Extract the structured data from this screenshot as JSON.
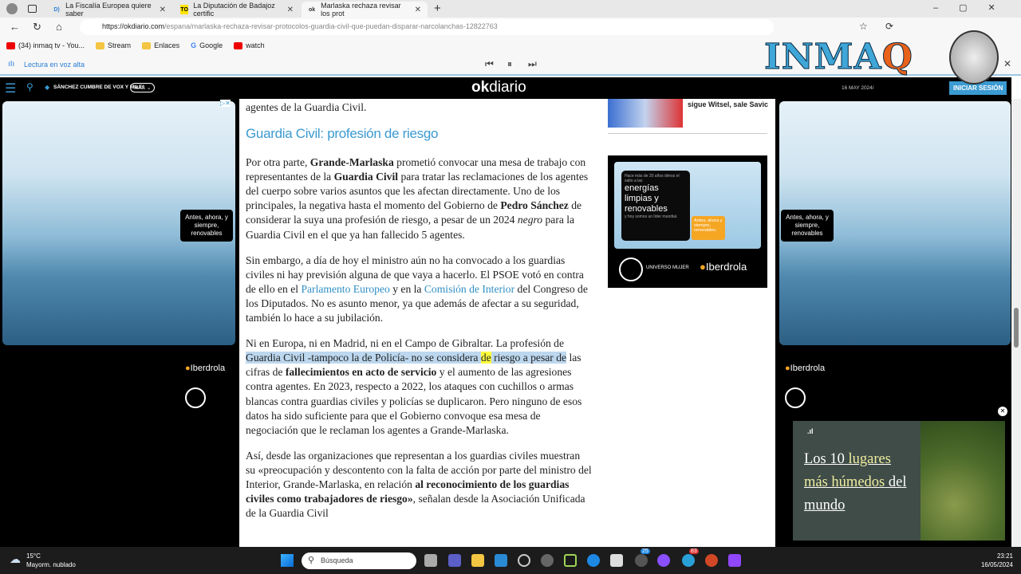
{
  "browser": {
    "tabs": [
      {
        "label": "La Fiscalía Europea quiere saber",
        "icon": "D)"
      },
      {
        "label": "La Diputación de Badajoz certific",
        "icon": "TO"
      },
      {
        "label": "Marlaska rechaza revisar los prot",
        "icon": "ok",
        "active": true
      }
    ],
    "url_domain": "https://okdiario.com",
    "url_path": "/espana/marlaska-rechaza-revisar-protocolos-guardia-civil-que-puedan-disparar-narcolanchas-12822763",
    "bookmarks": [
      "(34) inmaq tv - You...",
      "Stream",
      "Enlaces",
      "Google",
      "watch"
    ],
    "read_aloud": "Lectura en voz alta",
    "watermark": "INMAQ"
  },
  "site": {
    "ticker": "SÁNCHEZ CUMBRE DE VOX Y MILEI",
    "more": "MÁS",
    "logo_ok": "ok",
    "logo_rest": "diario",
    "date": "16 MAY 2024/",
    "login": "INICIAR SESIÓN"
  },
  "ads": {
    "left_tag": "Antes, ahora, y siempre, renovables",
    "brand": "Iberdrola",
    "mujer": "UNIVERSO MUJER",
    "center_heading": "energías limpias y renovables",
    "center_small": "Hace más de 20 años dimos el salto a las",
    "center_small2": "y hoy somos un líder mundial.",
    "center_orange": "Antes, ahora y siempre, renovables.",
    "promo_title_parts": [
      "Los 10 ",
      "lugares",
      " más húmedos",
      " del mundo"
    ]
  },
  "sidebar": {
    "related_title": "sigue Witsel, sale Savic"
  },
  "article": {
    "p0": "agentes de la Guardia Civil.",
    "heading": "Guardia Civil: profesión de riesgo",
    "p1": [
      [
        "Por otra parte, ",
        ""
      ],
      [
        "Grande-Marlaska",
        "b"
      ],
      [
        " prometió convocar una mesa de trabajo con representantes de la ",
        ""
      ],
      [
        "Guardia Civil",
        "b"
      ],
      [
        " para tratar las reclamaciones de los agentes del cuerpo sobre varios asuntos que les afectan directamente. Uno de los principales, la negativa hasta el momento del Gobierno de ",
        ""
      ],
      [
        "Pedro Sánchez",
        "b"
      ],
      [
        " de considerar la suya una profesión de riesgo, a pesar de un 2024 ",
        ""
      ],
      [
        "negro",
        "i"
      ],
      [
        " para la Guardia Civil en el que ya han fallecido 5 agentes.",
        ""
      ]
    ],
    "p2": [
      [
        "Sin embargo, a día de hoy el ministro aún no ha convocado a los guardias civiles ni hay previsión alguna de que vaya a hacerlo. El PSOE votó en contra de ello en el ",
        ""
      ],
      [
        "Parlamento Europeo",
        "a"
      ],
      [
        " y en la ",
        ""
      ],
      [
        "Comisión de Interior",
        "a"
      ],
      [
        " del Congreso de los Diputados. No es asunto menor, ya que además de afectar a su seguridad, también lo hace a su jubilación.",
        ""
      ]
    ],
    "p3": [
      [
        "Ni en Europa, ni en Madrid, ni en el Campo de Gibraltar. La profesión de ",
        ""
      ],
      [
        "Guardia Civil -tampoco la de Policía- no se considera ",
        "hl"
      ],
      [
        "de",
        "hly"
      ],
      [
        " riesgo a pesar de",
        "hl"
      ],
      [
        " las cifras de ",
        ""
      ],
      [
        "fallecimientos en acto de servicio",
        "b"
      ],
      [
        " y el aumento de las agresiones contra agentes. En 2023, respecto a 2022, los ataques con cuchillos o armas blancas contra guardias civiles y policías se duplicaron. Pero ninguno de esos datos ha sido suficiente para que el Gobierno convoque esa mesa de negociación que le reclaman los agentes a Grande-Marlaska.",
        ""
      ]
    ],
    "p4": [
      [
        "Así, desde las organizaciones que representan a los guardias civiles muestran su «preocupación y descontento con la falta de acción por parte del ministro del Interior, Grande-Marlaska, en relación ",
        ""
      ],
      [
        "al reconocimiento de los guardias civiles como trabajadores de riesgo»",
        "b"
      ],
      [
        ", señalan desde la Asociación Unificada de la Guardia Civil",
        ""
      ]
    ]
  },
  "taskbar": {
    "temp": "15°C",
    "weather": "Mayorm. nublado",
    "search": "Búsqueda",
    "time": "23:21",
    "date": "16/05/2024",
    "badge1": "25",
    "badge2": "83"
  }
}
